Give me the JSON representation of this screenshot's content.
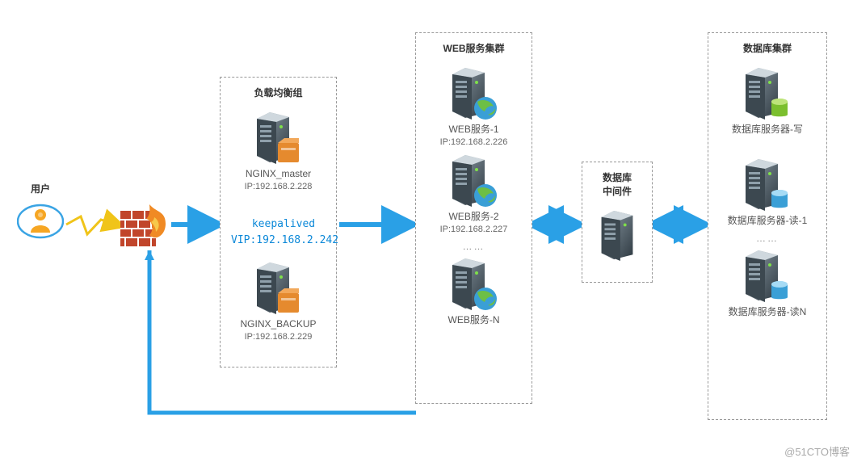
{
  "user": {
    "label": "用户"
  },
  "lb_group": {
    "title": "负载均衡组",
    "master": {
      "name": "NGINX_master",
      "ip": "IP:192.168.2.228"
    },
    "backup": {
      "name": "NGINX_BACKUP",
      "ip": "IP:192.168.2.229"
    }
  },
  "keepalived": {
    "line1": "keepalived",
    "line2": "VIP:192.168.2.242"
  },
  "web_group": {
    "title": "WEB服务集群",
    "n1": {
      "name": "WEB服务-1",
      "ip": "IP:192.168.2.226"
    },
    "n2": {
      "name": "WEB服务-2",
      "ip": "IP:192.168.2.227"
    },
    "dots": "……",
    "nN": {
      "name": "WEB服务-N"
    }
  },
  "middleware": {
    "title": "数据库\n中间件"
  },
  "db_group": {
    "title": "数据库集群",
    "write": {
      "name": "数据库服务器-写"
    },
    "read1": {
      "name": "数据库服务器-读-1"
    },
    "dots": "……",
    "readN": {
      "name": "数据库服务器-读N"
    }
  },
  "watermark": "@51CTO博客"
}
